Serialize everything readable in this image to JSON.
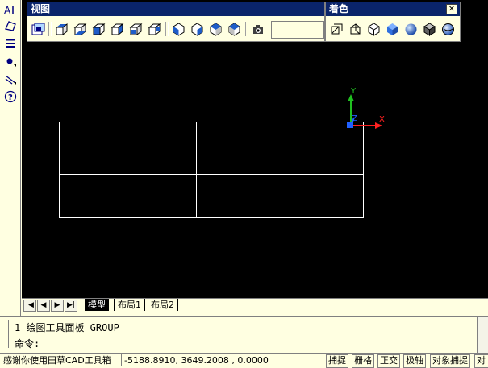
{
  "toolbars": {
    "view": {
      "title": "视图",
      "buttons": [
        "named-views",
        "top-view",
        "bottom-view",
        "left-view",
        "right-view",
        "front-view",
        "back-view",
        "sw-iso-view",
        "se-iso-view",
        "ne-iso-view",
        "nw-iso-view",
        "camera"
      ],
      "input_value": ""
    },
    "shade": {
      "title": "着色",
      "close_glyph": "✕",
      "buttons": [
        "2d-wireframe",
        "3d-wireframe",
        "hidden",
        "flat-shaded",
        "gouraud-shaded",
        "flat-shaded-edges",
        "gouraud-shaded-edges"
      ]
    },
    "left": {
      "buttons": [
        "text-icon",
        "polygon-icon",
        "lineweight-icon",
        "point-icon",
        "leader-icon",
        "help-icon"
      ]
    }
  },
  "ucs": {
    "x_label": "X",
    "y_label": "Y",
    "z_label": "Z"
  },
  "tabs": {
    "nav": [
      "|◀",
      "◀",
      "▶",
      "▶|"
    ],
    "model": "模型",
    "layout1": "布局1",
    "layout2": "布局2"
  },
  "command": {
    "history": "1 绘图工具面板 GROUP",
    "prompt": "命令:"
  },
  "status": {
    "message": "感谢你使用田草CAD工具箱",
    "coords": "-5188.8910, 3649.2008 , 0.0000",
    "snap": "捕捉",
    "grid": "栅格",
    "ortho": "正交",
    "polar": "极轴",
    "osnap": "对象捕捉",
    "otrack": "对"
  },
  "colors": {
    "canvas": "#000000",
    "panel": "#ffffe1",
    "titlebar": "#0a246a",
    "drawing_lines": "#ffffff",
    "axis_x": "#ff2020",
    "axis_y": "#20c020",
    "axis_z": "#2060ff"
  }
}
